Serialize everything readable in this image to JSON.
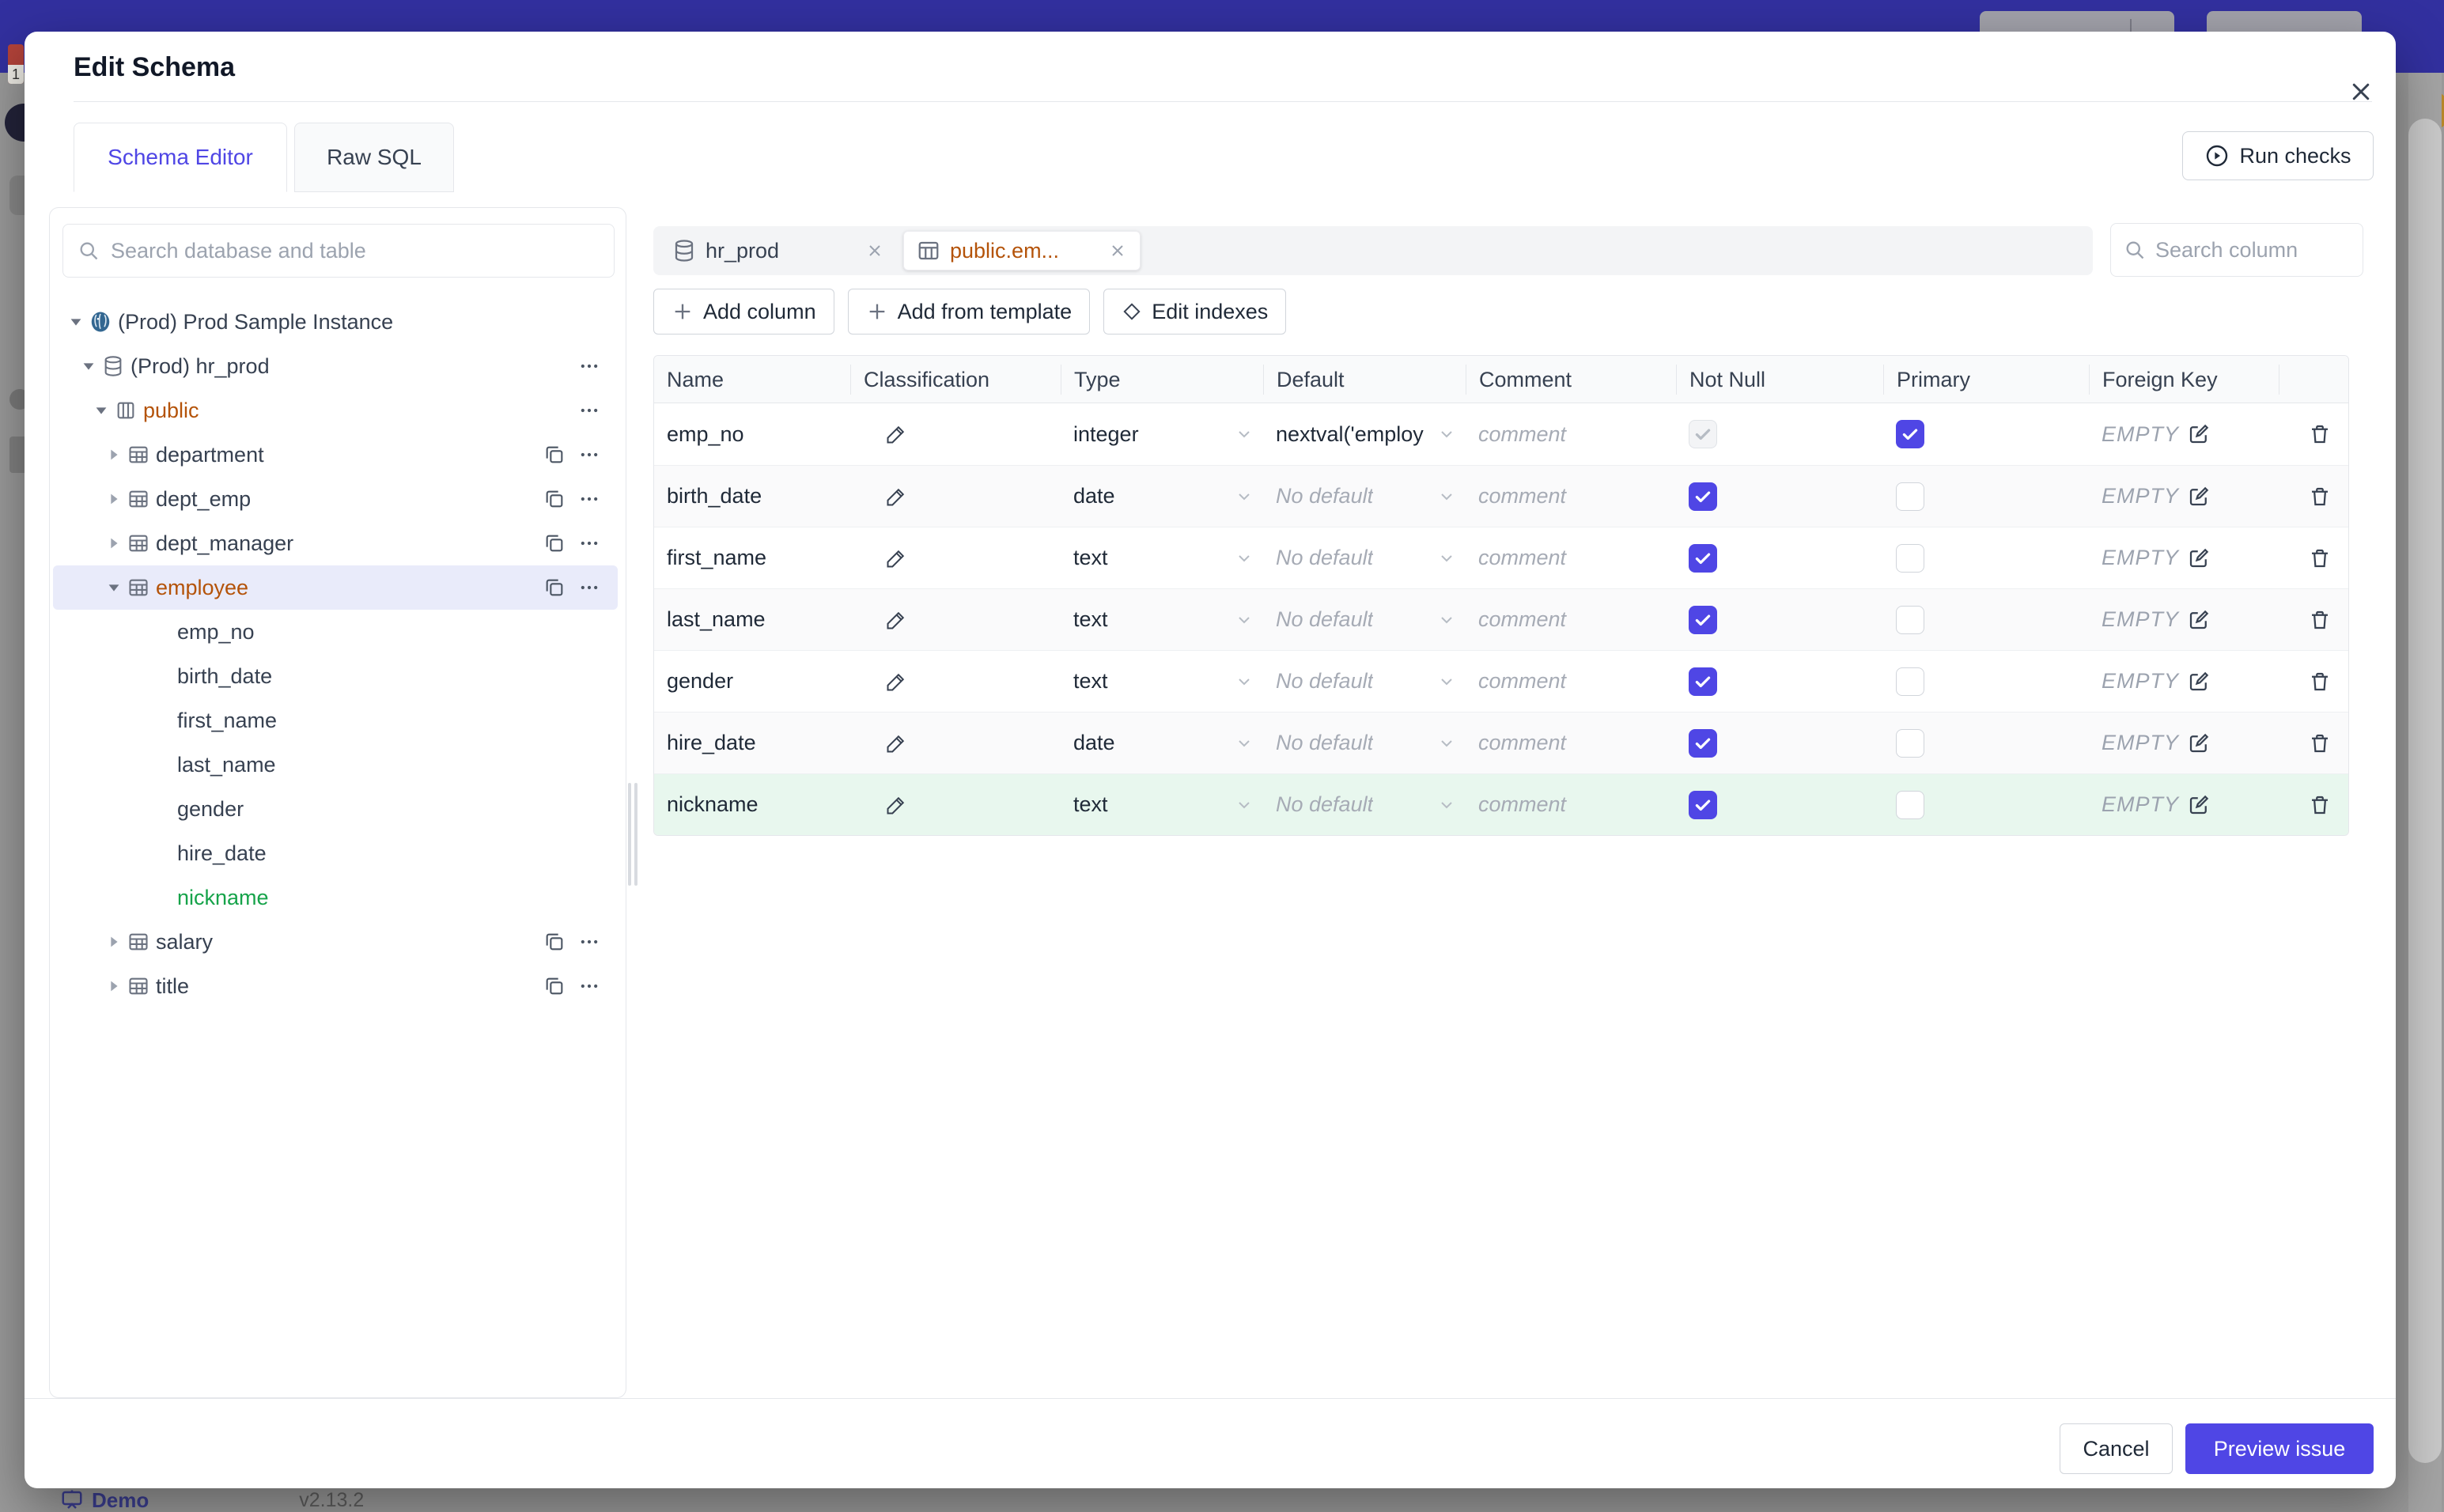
{
  "colors": {
    "accent": "#4f46e5",
    "amber": "#b45309",
    "green": "#16a34a",
    "topbar": "#32309f"
  },
  "modal": {
    "title": "Edit Schema",
    "tabs": [
      {
        "label": "Schema Editor",
        "active": true
      },
      {
        "label": "Raw SQL",
        "active": false
      }
    ],
    "run_checks_label": "Run checks",
    "footer": {
      "cancel_label": "Cancel",
      "primary_label": "Preview issue"
    }
  },
  "sidebar": {
    "search_placeholder": "Search database and table",
    "tree": [
      {
        "level": 1,
        "caret": "down",
        "icon": "postgres",
        "label": "(Prod) Prod Sample Instance"
      },
      {
        "level": 2,
        "caret": "down",
        "icon": "database",
        "label": "(Prod) hr_prod",
        "menu": true
      },
      {
        "level": 3,
        "caret": "down",
        "icon": "schema",
        "label": "public",
        "color": "#b45309",
        "menu": true
      },
      {
        "level": 4,
        "caret": "right",
        "icon": "table",
        "label": "department",
        "copy": true,
        "menu": true
      },
      {
        "level": 4,
        "caret": "right",
        "icon": "table",
        "label": "dept_emp",
        "copy": true,
        "menu": true
      },
      {
        "level": 4,
        "caret": "right",
        "icon": "table",
        "label": "dept_manager",
        "copy": true,
        "menu": true
      },
      {
        "level": 4,
        "caret": "down",
        "icon": "table",
        "label": "employee",
        "color": "#b45309",
        "copy": true,
        "menu": true,
        "selected": true
      },
      {
        "level": 5,
        "label": "emp_no"
      },
      {
        "level": 5,
        "label": "birth_date"
      },
      {
        "level": 5,
        "label": "first_name"
      },
      {
        "level": 5,
        "label": "last_name"
      },
      {
        "level": 5,
        "label": "gender"
      },
      {
        "level": 5,
        "label": "hire_date"
      },
      {
        "level": 5,
        "label": "nickname",
        "color": "#16a34a"
      },
      {
        "level": 4,
        "caret": "right",
        "icon": "table",
        "label": "salary",
        "copy": true,
        "menu": true
      },
      {
        "level": 4,
        "caret": "right",
        "icon": "table",
        "label": "title",
        "copy": true,
        "menu": true
      }
    ]
  },
  "main": {
    "chips": [
      {
        "icon": "database",
        "label": "hr_prod",
        "selected": false
      },
      {
        "icon": "table",
        "label": "public.em...",
        "selected": true
      }
    ],
    "column_search_placeholder": "Search column",
    "toolbar": [
      {
        "icon": "plus",
        "label": "Add column"
      },
      {
        "icon": "plus",
        "label": "Add from template"
      },
      {
        "icon": "diamond",
        "label": "Edit indexes"
      }
    ]
  },
  "table": {
    "headers": [
      "Name",
      "Classification",
      "Type",
      "Default",
      "Comment",
      "Not Null",
      "Primary",
      "Foreign Key"
    ],
    "comment_placeholder": "comment",
    "foreign_key_empty": "EMPTY",
    "rows": [
      {
        "name": "emp_no",
        "type": "integer",
        "default": "nextval('employ",
        "default_placeholder": false,
        "not_null": {
          "checked": true,
          "disabled": true
        },
        "primary": {
          "checked": true
        },
        "bg": "white"
      },
      {
        "name": "birth_date",
        "type": "date",
        "default": "No default",
        "default_placeholder": true,
        "not_null": {
          "checked": true,
          "disabled": false
        },
        "primary": {
          "checked": false
        },
        "bg": "stripe"
      },
      {
        "name": "first_name",
        "type": "text",
        "default": "No default",
        "default_placeholder": true,
        "not_null": {
          "checked": true,
          "disabled": false
        },
        "primary": {
          "checked": false
        },
        "bg": "white"
      },
      {
        "name": "last_name",
        "type": "text",
        "default": "No default",
        "default_placeholder": true,
        "not_null": {
          "checked": true,
          "disabled": false
        },
        "primary": {
          "checked": false
        },
        "bg": "stripe"
      },
      {
        "name": "gender",
        "type": "text",
        "default": "No default",
        "default_placeholder": true,
        "not_null": {
          "checked": true,
          "disabled": false
        },
        "primary": {
          "checked": false
        },
        "bg": "white"
      },
      {
        "name": "hire_date",
        "type": "date",
        "default": "No default",
        "default_placeholder": true,
        "not_null": {
          "checked": true,
          "disabled": false
        },
        "primary": {
          "checked": false
        },
        "bg": "stripe"
      },
      {
        "name": "nickname",
        "type": "text",
        "default": "No default",
        "default_placeholder": true,
        "not_null": {
          "checked": true,
          "disabled": false
        },
        "primary": {
          "checked": false
        },
        "bg": "green"
      }
    ]
  },
  "statusbar": {
    "demo_label": "Demo",
    "version": "v2.13.2"
  }
}
